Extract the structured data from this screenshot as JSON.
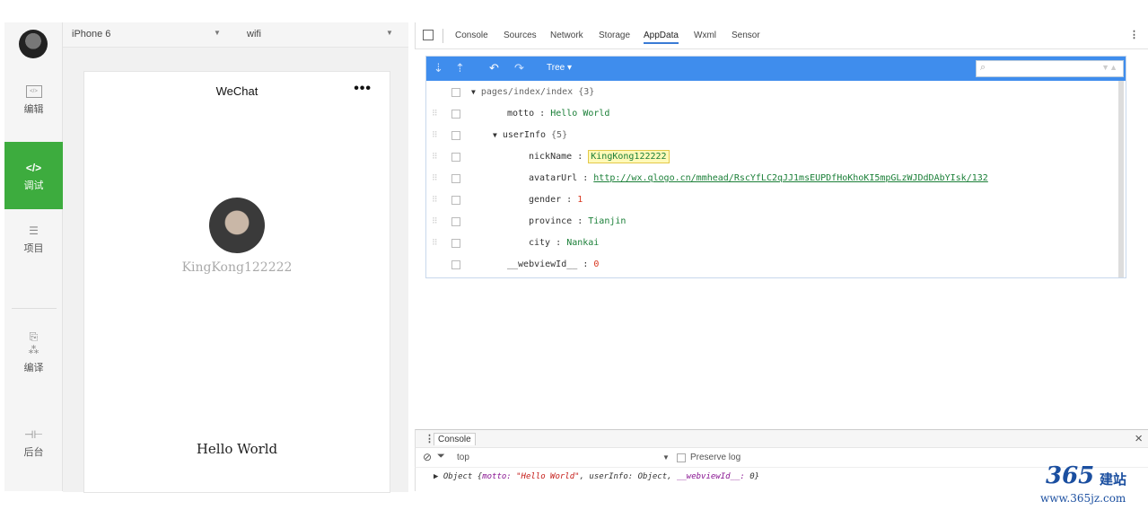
{
  "sidebar": {
    "items": [
      {
        "label": "编辑",
        "icon": "code-box-icon"
      },
      {
        "label": "调试",
        "icon": "code-icon",
        "icon_glyph": "</>"
      },
      {
        "label": "项目",
        "icon": "menu-lines-icon"
      },
      {
        "label": "编译",
        "icon": "compile-icon"
      },
      {
        "label": "后台",
        "icon": "backend-icon"
      }
    ],
    "accent_color": "#3dac3e"
  },
  "device_bar": {
    "device": "iPhone 6",
    "network": "wifi"
  },
  "phone": {
    "nav_title": "WeChat",
    "menu_dots": "•••",
    "nickname": "KingKong122222",
    "motto": "Hello World"
  },
  "devtools": {
    "tabs": [
      "Console",
      "Sources",
      "Network",
      "Storage",
      "AppData",
      "Wxml",
      "Sensor"
    ],
    "active_tab": "AppData"
  },
  "appdata": {
    "view_mode": "Tree",
    "root": "pages/index/index",
    "root_count": "{3}",
    "motto_key": "motto",
    "motto_val": "Hello World",
    "userinfo_key": "userInfo",
    "userinfo_count": "{5}",
    "nickname_key": "nickName",
    "nickname_val": "KingKong122222",
    "avatar_key": "avatarUrl",
    "avatar_val": "http://wx.qlogo.cn/mmhead/RscYfLC2qJJ1msEUPDfHoKhoKI5mpGLzWJDdDAbYIsk/132",
    "gender_key": "gender",
    "gender_val": "1",
    "province_key": "province",
    "province_val": "Tianjin",
    "city_key": "city",
    "city_val": "Nankai",
    "webview_key": "__webviewId__",
    "webview_val": "0",
    "separator": ":"
  },
  "console": {
    "tab": "Console",
    "context": "top",
    "preserve_log": "Preserve log",
    "log_prefix": "▶ Object {",
    "log_motto_key": "motto:",
    "log_motto_val": "\"Hello World\"",
    "log_mid": ", userInfo: Object, ",
    "log_webview_key": "__webviewId__:",
    "log_webview_val": " 0",
    "log_suffix": "}"
  },
  "watermark": {
    "digits": "365",
    "cn": "建站",
    "url": "www.365jz.com"
  }
}
